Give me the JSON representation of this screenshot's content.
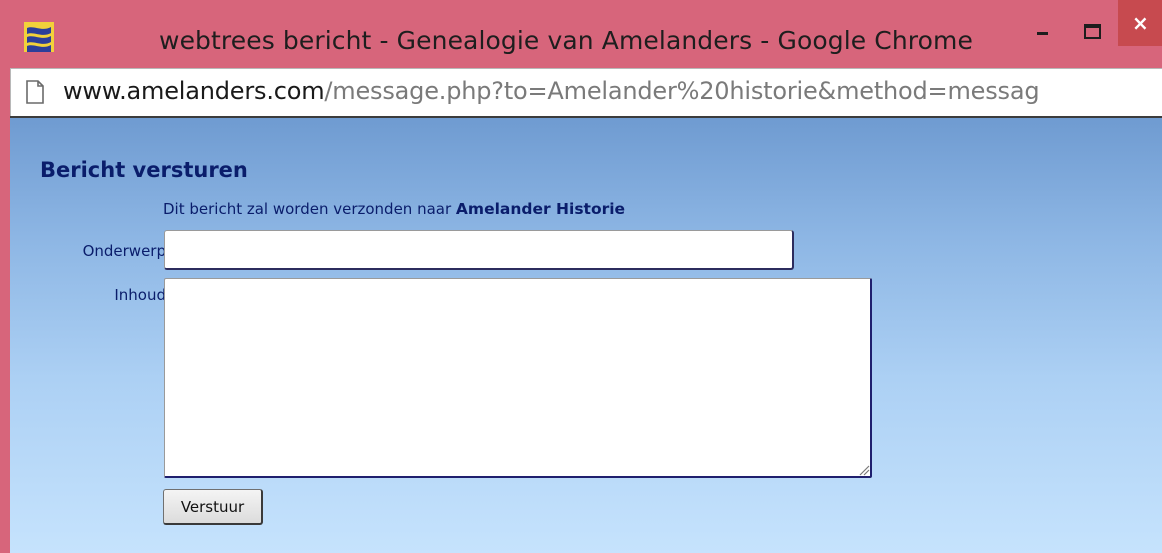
{
  "window": {
    "title": "webtrees bericht - Genealogie van Amelanders - Google Chrome",
    "close_label": "×"
  },
  "address_bar": {
    "host": "www.amelanders.com",
    "path": "/message.php?to=Amelander%20historie&method=messag"
  },
  "form": {
    "heading": "Bericht versturen",
    "info_prefix": "Dit bericht zal worden verzonden naar ",
    "recipient": "Amelander Historie",
    "subject_label": "Onderwerp",
    "subject_value": "",
    "body_label": "Inhoud",
    "body_value": "",
    "submit_label": "Verstuur"
  },
  "colors": {
    "titlebar": "#d7657b",
    "close_button": "#c74a4f",
    "text_dark_blue": "#0a1d6b",
    "content_gradient_top": "#6f9bd1",
    "content_gradient_bottom": "#c6e3fd"
  },
  "icons": {
    "app": "webtrees-app-icon",
    "page": "page-icon"
  }
}
